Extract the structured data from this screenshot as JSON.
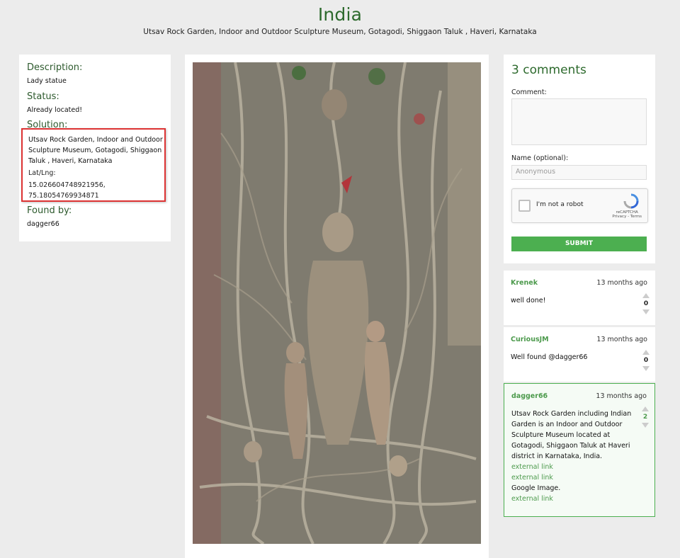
{
  "header": {
    "title": "India",
    "subtitle": "Utsav Rock Garden, Indoor and Outdoor Sculpture Museum, Gotagodi, Shiggaon Taluk , Haveri, Karnataka"
  },
  "info": {
    "description_label": "Description:",
    "description": "Lady statue",
    "status_label": "Status:",
    "status": "Already located!",
    "solution_label": "Solution:",
    "solution": "Utsav Rock Garden, Indoor and Outdoor Sculpture Museum, Gotagodi, Shiggaon Taluk , Haveri, Karnataka",
    "latlng_label": "Lat/Lng:",
    "lat": "15.026604748921956,",
    "lng": "75.18054769934871",
    "found_by_label": "Found by:",
    "found_by": "dagger66"
  },
  "form": {
    "comments_title": "3 comments",
    "comment_label": "Comment:",
    "name_label": "Name (optional):",
    "name_placeholder": "Anonymous",
    "captcha_text": "I'm not a robot",
    "captcha_brand": "reCAPTCHA",
    "captcha_links": "Privacy - Terms",
    "submit_label": "SUBMIT"
  },
  "comments": [
    {
      "author": "Krenek",
      "time": "13 months ago",
      "body": "well done!",
      "votes": "0"
    },
    {
      "author": "CuriousJM",
      "time": "13 months ago",
      "body": "Well found @dagger66",
      "votes": "0"
    },
    {
      "author": "dagger66",
      "time": "13 months ago",
      "body": "Utsav Rock Garden including Indian Garden is an Indoor and Outdoor Sculpture Museum located at Gotagodi, Shiggaon Taluk at Haveri district in Karnataka, India.",
      "link1": "external link",
      "link2": "external link",
      "google": "Google Image.",
      "link3": "external link",
      "votes": "2"
    }
  ],
  "colors": {
    "accent": "#2d6a2d",
    "link": "#4c9a4c",
    "submit": "#4caf50",
    "highlight_border": "#d33"
  }
}
